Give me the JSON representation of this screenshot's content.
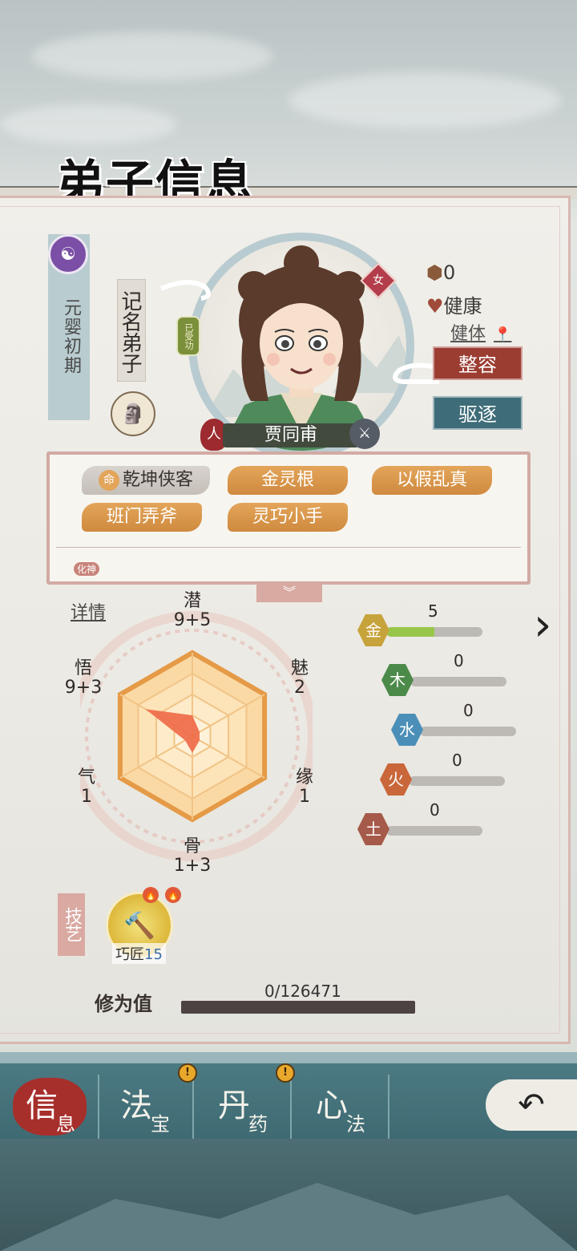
{
  "header": {
    "title": "弟子信息"
  },
  "realm": {
    "icon": "yin-yang-icon",
    "badge_glyph": "☯",
    "text": "元婴初期"
  },
  "rank": {
    "text": "记名弟子"
  },
  "portrait": {
    "learned_badge": "已受功",
    "gender": "女"
  },
  "character": {
    "race": "人",
    "name": "贾同甫"
  },
  "status": {
    "count": "0",
    "health": "健康",
    "physique": "健体",
    "restyle_button": "整容",
    "expel_button": "驱逐"
  },
  "traits": [
    {
      "label": "乾坤侠客",
      "badge": "命"
    },
    {
      "label": "金灵根"
    },
    {
      "label": "以假乱真"
    },
    {
      "label": "班门弄斧"
    },
    {
      "label": "灵巧小手"
    }
  ],
  "traits_extra": "化神",
  "details_link": "详情",
  "attributes": {
    "qian": {
      "name": "潜",
      "value": "9+5"
    },
    "mei": {
      "name": "魅",
      "value": "2"
    },
    "yuan": {
      "name": "缘",
      "value": "1"
    },
    "gu": {
      "name": "骨",
      "value": "1+3"
    },
    "qi": {
      "name": "气",
      "value": "1"
    },
    "wu": {
      "name": "悟",
      "value": "9+3"
    }
  },
  "radar_values": [
    0.25,
    0.1,
    0.1,
    0.2,
    0.1,
    0.65
  ],
  "elements": [
    {
      "glyph": "金",
      "value": "5",
      "fraction": 0.5,
      "color": "#c7a33b"
    },
    {
      "glyph": "木",
      "value": "0",
      "fraction": 0,
      "color": "#4c8a4a"
    },
    {
      "glyph": "水",
      "value": "0",
      "fraction": 0,
      "color": "#4b8fb8"
    },
    {
      "glyph": "火",
      "value": "0",
      "fraction": 0,
      "color": "#c9673a"
    },
    {
      "glyph": "土",
      "value": "0",
      "fraction": 0,
      "color": "#a55a4a"
    }
  ],
  "skills": {
    "label": "技艺",
    "name": "巧匠",
    "level": "15",
    "icon": "hammer-icon"
  },
  "cultivation": {
    "label": "修为值",
    "value": "0/126471",
    "progress": 0
  },
  "nav": {
    "tabs": [
      {
        "big": "信",
        "small": "息",
        "active": true
      },
      {
        "big": "法",
        "small": "宝",
        "alert": true
      },
      {
        "big": "丹",
        "small": "药",
        "alert": true
      },
      {
        "big": "心",
        "small": "法"
      }
    ],
    "alert_glyph": "!",
    "back_icon": "back-arrow-icon"
  }
}
